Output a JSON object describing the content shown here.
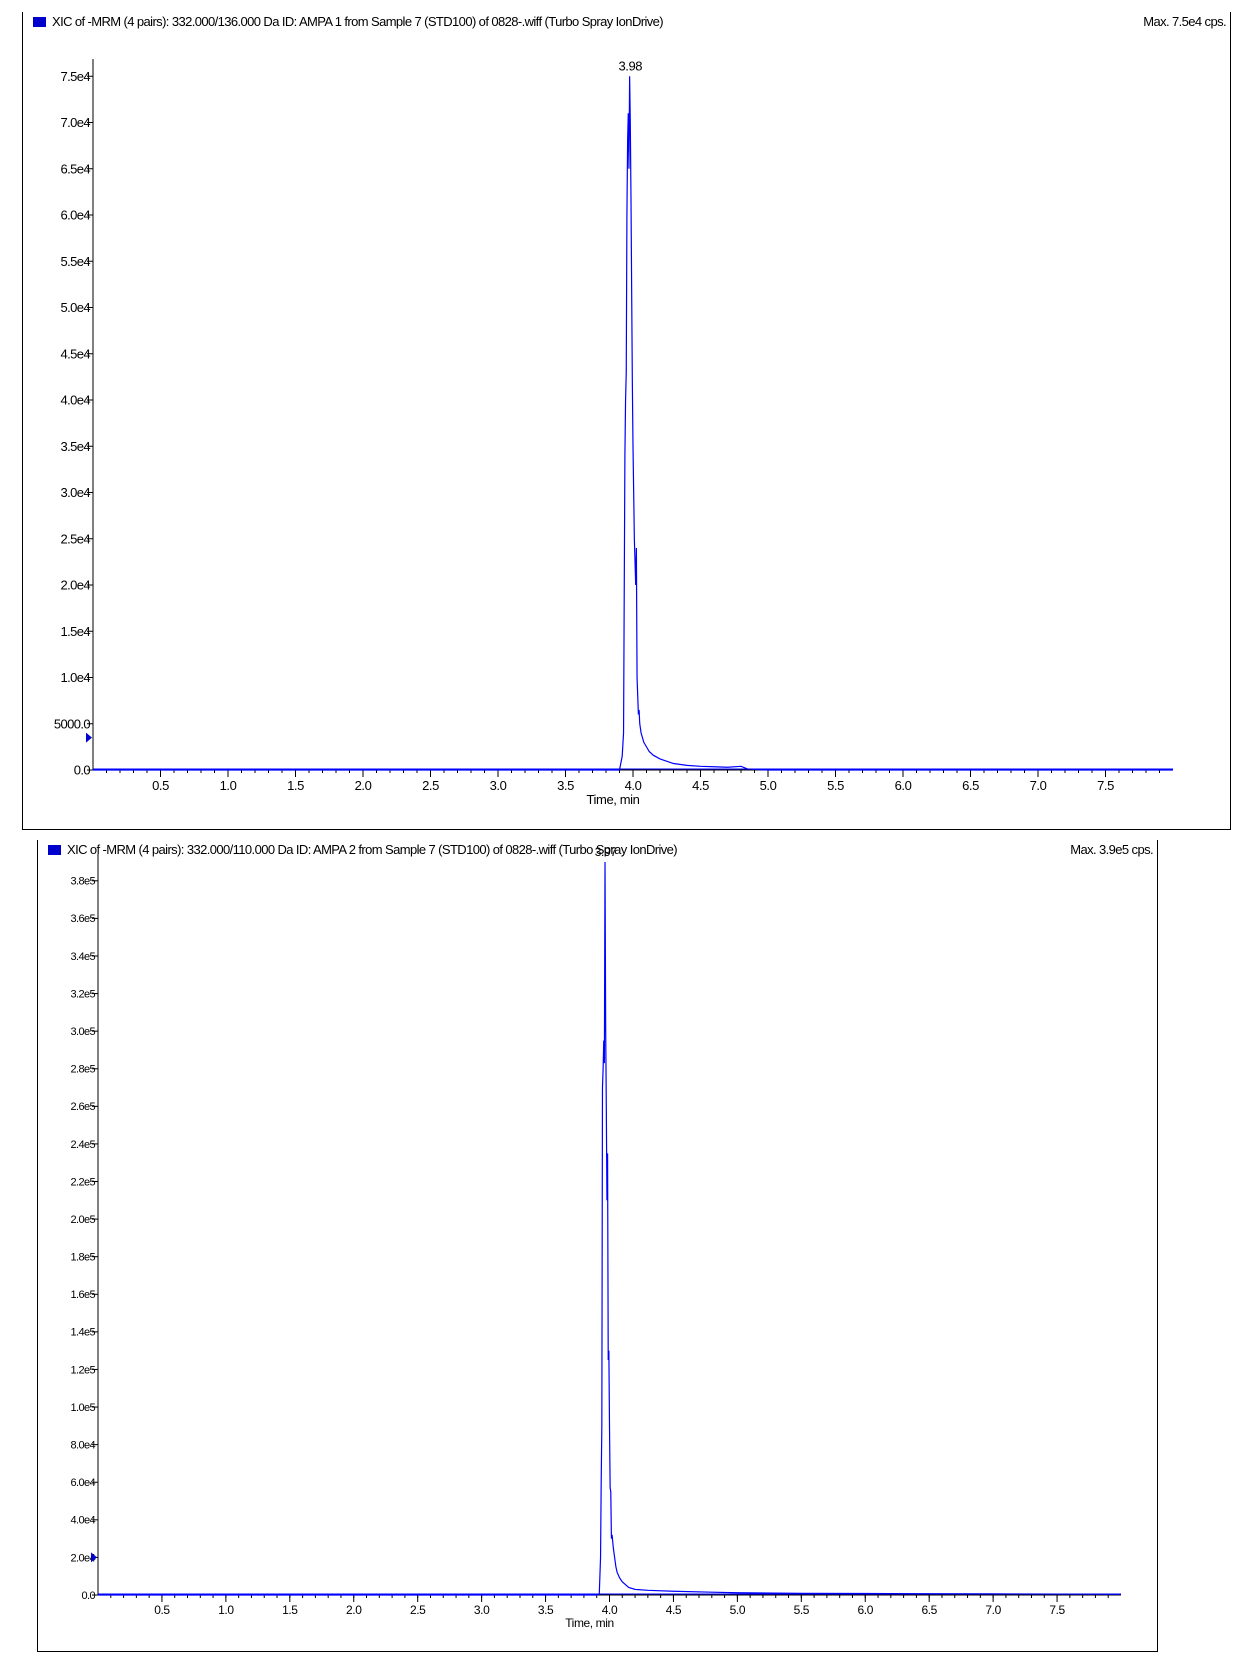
{
  "colors": {
    "trace": "#0000ff",
    "swatch": "#0000cc",
    "axis": "#000000"
  },
  "chart_data": [
    {
      "type": "line",
      "header": "XIC of -MRM (4 pairs): 332.000/136.000 Da ID: AMPA 1 from Sample 7 (STD100) of 0828-.wiff (Turbo Spray IonDrive)",
      "max_label": "Max. 7.5e4 cps.",
      "xlabel": "Time, min",
      "ylabel": "",
      "xlim": [
        0,
        8.0
      ],
      "ylim": [
        0,
        76000
      ],
      "x_ticks": [
        "0.5",
        "1.0",
        "1.5",
        "2.0",
        "2.5",
        "3.0",
        "3.5",
        "4.0",
        "4.5",
        "5.0",
        "5.5",
        "6.0",
        "6.5",
        "7.0",
        "7.5"
      ],
      "y_ticks": [
        {
          "v": 0,
          "label": "0.0"
        },
        {
          "v": 5000,
          "label": "5000.0"
        },
        {
          "v": 10000,
          "label": "1.0e4"
        },
        {
          "v": 15000,
          "label": "1.5e4"
        },
        {
          "v": 20000,
          "label": "2.0e4"
        },
        {
          "v": 25000,
          "label": "2.5e4"
        },
        {
          "v": 30000,
          "label": "3.0e4"
        },
        {
          "v": 35000,
          "label": "3.5e4"
        },
        {
          "v": 40000,
          "label": "4.0e4"
        },
        {
          "v": 45000,
          "label": "4.5e4"
        },
        {
          "v": 50000,
          "label": "5.0e4"
        },
        {
          "v": 55000,
          "label": "5.5e4"
        },
        {
          "v": 60000,
          "label": "6.0e4"
        },
        {
          "v": 65000,
          "label": "6.5e4"
        },
        {
          "v": 70000,
          "label": "7.0e4"
        },
        {
          "v": 75000,
          "label": "7.5e4"
        }
      ],
      "y_marker": 3500,
      "peak": {
        "x": 3.98,
        "y": 75000,
        "label": "3.98"
      },
      "series": [
        {
          "x": [
            0,
            3.5,
            3.9,
            3.92,
            3.93,
            3.94,
            3.945,
            3.95,
            3.955,
            3.96,
            3.965,
            3.97,
            3.975,
            3.98,
            3.985,
            3.99,
            3.995,
            4.0,
            4.01,
            4.02,
            4.025,
            4.03,
            4.035,
            4.04,
            4.045,
            4.05,
            4.06,
            4.07,
            4.08,
            4.1,
            4.12,
            4.15,
            4.2,
            4.3,
            4.4,
            4.5,
            4.6,
            4.7,
            4.8,
            4.85,
            5.0,
            6.0,
            7.0,
            8.0
          ],
          "y": [
            0,
            0,
            0,
            1500,
            4000,
            34000,
            40000,
            43000,
            60000,
            68000,
            71000,
            65000,
            75000,
            70000,
            62000,
            52000,
            42000,
            35000,
            25000,
            20000,
            24000,
            10000,
            8000,
            6000,
            6500,
            5000,
            4000,
            3500,
            3000,
            2500,
            2000,
            1600,
            1200,
            700,
            500,
            400,
            350,
            300,
            400,
            100,
            0,
            0,
            0,
            0
          ]
        }
      ]
    },
    {
      "type": "line",
      "header": "XIC of -MRM (4 pairs): 332.000/110.000 Da ID: AMPA 2 from Sample 7 (STD100) of 0828-.wiff (Turbo Spray IonDrive)",
      "max_label": "Max. 3.9e5 cps.",
      "xlabel": "Time, min",
      "ylabel": "",
      "xlim": [
        0,
        8.0
      ],
      "ylim": [
        0,
        390000
      ],
      "x_ticks": [
        "0.5",
        "1.0",
        "1.5",
        "2.0",
        "2.5",
        "3.0",
        "3.5",
        "4.0",
        "4.5",
        "5.0",
        "5.5",
        "6.0",
        "6.5",
        "7.0",
        "7.5"
      ],
      "y_ticks": [
        {
          "v": 0,
          "label": "0.0"
        },
        {
          "v": 20000,
          "label": "2.0e4"
        },
        {
          "v": 40000,
          "label": "4.0e4"
        },
        {
          "v": 60000,
          "label": "6.0e4"
        },
        {
          "v": 80000,
          "label": "8.0e4"
        },
        {
          "v": 100000,
          "label": "1.0e5"
        },
        {
          "v": 120000,
          "label": "1.2e5"
        },
        {
          "v": 140000,
          "label": "1.4e5"
        },
        {
          "v": 160000,
          "label": "1.6e5"
        },
        {
          "v": 180000,
          "label": "1.8e5"
        },
        {
          "v": 200000,
          "label": "2.0e5"
        },
        {
          "v": 220000,
          "label": "2.2e5"
        },
        {
          "v": 240000,
          "label": "2.4e5"
        },
        {
          "v": 260000,
          "label": "2.6e5"
        },
        {
          "v": 280000,
          "label": "2.8e5"
        },
        {
          "v": 300000,
          "label": "3.0e5"
        },
        {
          "v": 320000,
          "label": "3.2e5"
        },
        {
          "v": 340000,
          "label": "3.4e5"
        },
        {
          "v": 360000,
          "label": "3.6e5"
        },
        {
          "v": 380000,
          "label": "3.8e5"
        }
      ],
      "y_marker": 20000,
      "peak": {
        "x": 3.97,
        "y": 390000,
        "label": "3.97"
      },
      "series": [
        {
          "x": [
            0,
            3.5,
            3.9,
            3.92,
            3.93,
            3.935,
            3.94,
            3.945,
            3.95,
            3.955,
            3.96,
            3.965,
            3.97,
            3.975,
            3.98,
            3.985,
            3.99,
            3.995,
            4.0,
            4.005,
            4.01,
            4.015,
            4.02,
            4.03,
            4.04,
            4.05,
            4.06,
            4.08,
            4.1,
            4.15,
            4.2,
            4.3,
            4.5,
            4.8,
            5.0,
            5.5,
            6.0,
            6.5,
            7.0,
            7.5,
            8.0
          ],
          "y": [
            0,
            0,
            0,
            500,
            20000,
            60000,
            90000,
            270000,
            280000,
            295000,
            283000,
            390000,
            303000,
            260000,
            210000,
            235000,
            125000,
            130000,
            90000,
            57000,
            55000,
            30000,
            32000,
            25000,
            20000,
            15000,
            12000,
            9000,
            7000,
            4000,
            3000,
            2500,
            2000,
            1500,
            1200,
            900,
            800,
            700,
            600,
            500,
            400
          ]
        }
      ]
    }
  ]
}
